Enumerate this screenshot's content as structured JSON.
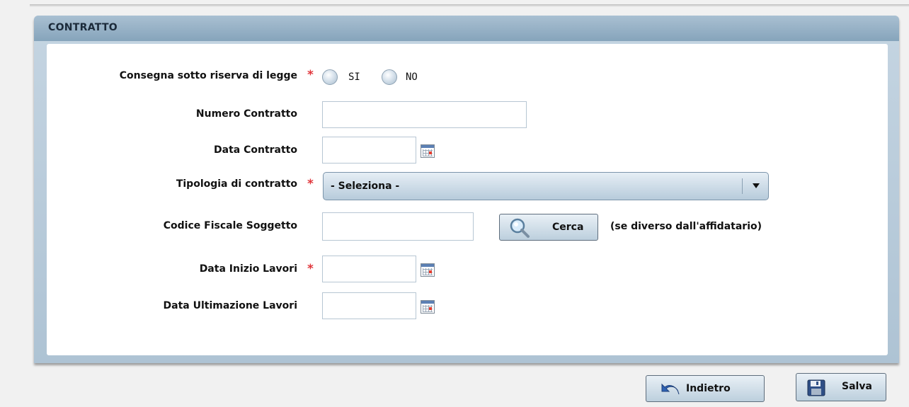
{
  "panel": {
    "title": "CONTRATTO"
  },
  "fields": {
    "consegna": {
      "label": "Consegna sotto riserva di legge",
      "required_mark": "*",
      "option_si": "SI",
      "option_no": "NO"
    },
    "numero_contratto": {
      "label": "Numero Contratto",
      "value": ""
    },
    "data_contratto": {
      "label": "Data Contratto",
      "value": ""
    },
    "tipologia": {
      "label": "Tipologia di contratto",
      "required_mark": "*",
      "selected": "- Seleziona -"
    },
    "codice_fiscale": {
      "label": "Codice Fiscale Soggetto",
      "value": "",
      "search_button": "Cerca",
      "note": "(se diverso dall'affidatario)"
    },
    "data_inizio": {
      "label": "Data Inizio Lavori",
      "required_mark": "*",
      "value": ""
    },
    "data_ultimazione": {
      "label": "Data Ultimazione Lavori",
      "value": ""
    }
  },
  "footer": {
    "back_label": "Indietro",
    "save_label": "Salva"
  },
  "colors": {
    "required": "#e0353b",
    "panel_header": "#86a4bb",
    "calendar_header": "#5c80b4"
  },
  "icons": [
    "calendar-icon",
    "search-magnifier-icon",
    "undo-arrow-icon",
    "floppy-disk-icon",
    "dropdown-arrow-icon"
  ]
}
